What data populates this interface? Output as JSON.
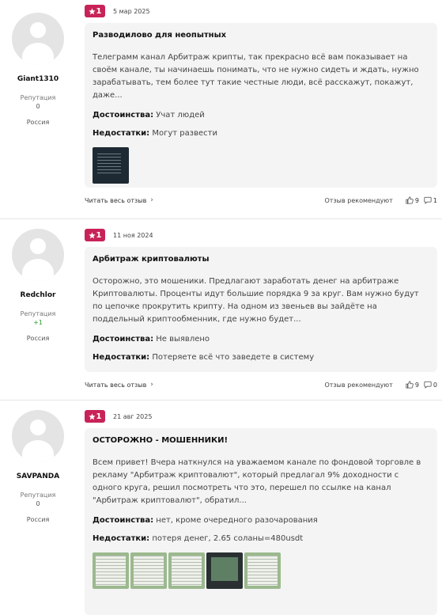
{
  "reviews": [
    {
      "username": "Giant1310",
      "rep_label": "Репутация",
      "rep_value": "0",
      "country": "Россия",
      "rating": "1",
      "date": "5 мар 2025",
      "title": "Разводилово для неопытных",
      "text": "Телеграмм канал Арбитраж крипты, так прекрасно всё вам показывает на своём канале, ты начинаешь понимать, что не нужно сидеть и ждать, нужно зарабатывать, тем более тут такие честные люди, всё расскажут, покажут, даже...",
      "pros_label": "Достоинства:",
      "pros": "Учат людей",
      "cons_label": "Недостатки:",
      "cons": "Могут развести",
      "read_more": "Читать весь отзыв",
      "recommend": "Отзыв рекомендуют",
      "likes": "9",
      "comments": "1"
    },
    {
      "username": "Redchlor",
      "rep_label": "Репутация",
      "rep_value": "+1",
      "country": "Россия",
      "rating": "1",
      "date": "11 ноя 2024",
      "title": "Арбитраж криптовалюты",
      "text": "Осторожно, это мошеники. Предлагают заработать денег на арбитраже Криптовалюты. Проценты идут большие порядка 9 за круг. Вам нужно будут по цепочке прокрутить крипту. На одном из звеньев вы зайдёте на поддельный криптообменник, где нужно будет...",
      "pros_label": "Достоинства:",
      "pros": "Не выявлено",
      "cons_label": "Недостатки:",
      "cons": "Потеряете всё что заведете в систему",
      "read_more": "Читать весь отзыв",
      "recommend": "Отзыв рекомендуют",
      "likes": "9",
      "comments": "0"
    },
    {
      "username": "SAVPANDA",
      "rep_label": "Репутация",
      "rep_value": "0",
      "country": "Россия",
      "rating": "1",
      "date": "21 авг 2025",
      "title": "ОСТОРОЖНО - МОШЕННИКИ!",
      "text": "Всем привет! Вчера наткнулся на уважаемом канале по фондовой торговле в рекламу \"Арбитраж криптовалют\", который предлагал 9% доходности с одного круга, решил посмотреть что это, перешел по ссылке на канал \"Арбитраж криптовалют\", обратил...",
      "pros_label": "Достоинства:",
      "pros": "нет, кроме очередного разочарования",
      "cons_label": "Недостатки:",
      "cons": "потеря денег, 2.65 соланы=480usdt"
    }
  ]
}
